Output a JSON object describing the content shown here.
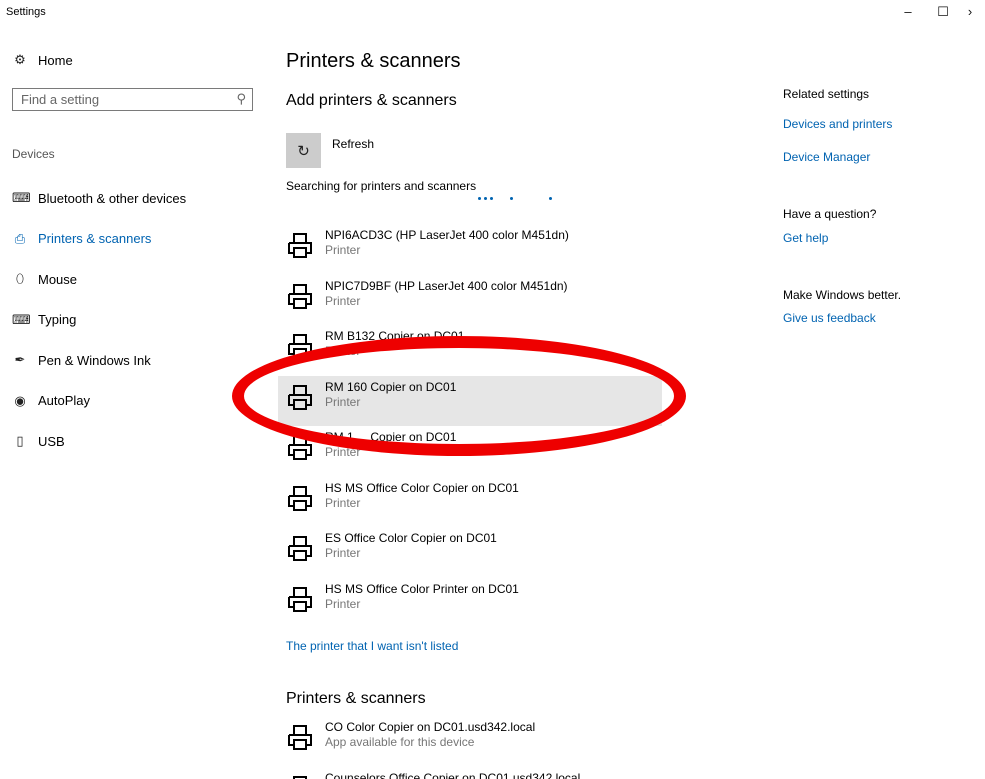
{
  "window": {
    "title": "Settings",
    "minimize": "–",
    "maximize": "☐",
    "close": "›"
  },
  "sidebar": {
    "home_label": "Home",
    "search_placeholder": "Find a setting",
    "section_label": "Devices",
    "items": [
      {
        "label": "Bluetooth & other devices",
        "icon": "keyboard-bluetooth-icon",
        "glyph": "⌨"
      },
      {
        "label": "Printers & scanners",
        "icon": "printer-icon",
        "glyph": "⎙"
      },
      {
        "label": "Mouse",
        "icon": "mouse-icon",
        "glyph": "⬯"
      },
      {
        "label": "Typing",
        "icon": "keyboard-icon",
        "glyph": "⌨"
      },
      {
        "label": "Pen & Windows Ink",
        "icon": "pen-icon",
        "glyph": "✒"
      },
      {
        "label": "AutoPlay",
        "icon": "autoplay-icon",
        "glyph": "◉"
      },
      {
        "label": "USB",
        "icon": "usb-icon",
        "glyph": "▯"
      }
    ]
  },
  "main": {
    "page_title": "Printers & scanners",
    "add_title": "Add printers & scanners",
    "refresh_label": "Refresh",
    "searching_text": "Searching for printers and scanners",
    "devices": [
      {
        "name": "NPI6ACD3C (HP LaserJet 400 color M451dn)",
        "type": "Printer"
      },
      {
        "name": "NPIC7D9BF (HP LaserJet 400 color M451dn)",
        "type": "Printer"
      },
      {
        "name": "RM B132 Copier on DC01",
        "type": "Printer"
      },
      {
        "name": "RM 160 Copier on DC01",
        "type": "Printer"
      },
      {
        "name": "RM 1__ Copier on DC01",
        "type": "Printer"
      },
      {
        "name": "HS MS Office Color Copier on DC01",
        "type": "Printer"
      },
      {
        "name": "ES Office Color Copier on DC01",
        "type": "Printer"
      },
      {
        "name": "HS MS Office Color Printer on DC01",
        "type": "Printer"
      }
    ],
    "not_listed_link": "The printer that I want isn't listed",
    "installed_title": "Printers & scanners",
    "installed": [
      {
        "name": "CO Color Copier on DC01.usd342.local",
        "type": "App available for this device"
      },
      {
        "name": "Counselors Office Copier on DC01.usd342.local",
        "type": ""
      }
    ]
  },
  "related": {
    "heading": "Related settings",
    "devices_printers": "Devices and printers",
    "device_manager": "Device Manager",
    "question_heading": "Have a question?",
    "get_help": "Get help",
    "better_heading": "Make Windows better.",
    "feedback": "Give us feedback"
  },
  "colors": {
    "accent": "#0063b1",
    "annotation": "#ee0000",
    "selected_row": "#e6e6e6"
  }
}
